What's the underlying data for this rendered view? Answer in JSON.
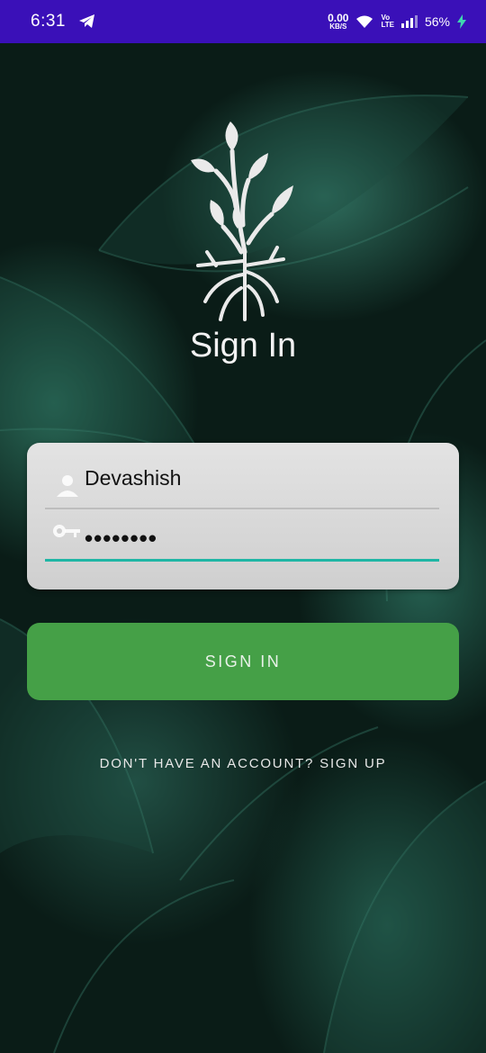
{
  "status_bar": {
    "time": "6:31",
    "net_speed_value": "0.00",
    "net_speed_unit": "KB/S",
    "volte_top": "Vo",
    "volte_bottom": "LTE",
    "battery": "56%",
    "icons": [
      "telegram-icon",
      "wifi-icon",
      "signal-icon",
      "battery-charging-icon"
    ]
  },
  "screen": {
    "title": "Sign In"
  },
  "form": {
    "username_value": "Devashish",
    "password_value": "••••••••"
  },
  "actions": {
    "signin_label": "SIGN IN",
    "signup_label": "DON'T HAVE AN ACCOUNT? SIGN UP"
  },
  "colors": {
    "status_bar": "#3a10b8",
    "button": "#45a047",
    "focus_underline": "#1fb6a5"
  }
}
